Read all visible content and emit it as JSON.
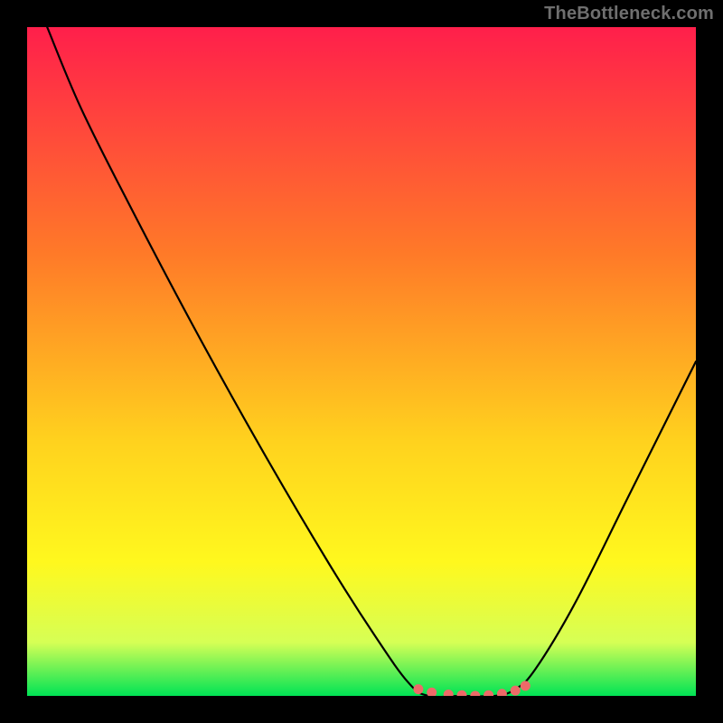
{
  "watermark": "TheBottleneck.com",
  "colors": {
    "bg_black": "#000000",
    "gradient_top": "#ff1f4b",
    "gradient_mid1": "#ff7a28",
    "gradient_mid2": "#ffd21e",
    "gradient_mid3": "#fff81e",
    "gradient_mid4": "#d6ff55",
    "gradient_bot": "#00e355",
    "curve": "#000000",
    "marker": "#ed6a68"
  },
  "chart_data": {
    "type": "line",
    "title": "",
    "xlabel": "",
    "ylabel": "",
    "xlim": [
      0,
      100
    ],
    "ylim": [
      0,
      100
    ],
    "grid": false,
    "legend": false,
    "curve": [
      {
        "x": 3,
        "y": 100
      },
      {
        "x": 8,
        "y": 88
      },
      {
        "x": 15,
        "y": 74
      },
      {
        "x": 25,
        "y": 55
      },
      {
        "x": 35,
        "y": 37
      },
      {
        "x": 45,
        "y": 20
      },
      {
        "x": 52,
        "y": 9
      },
      {
        "x": 57,
        "y": 2
      },
      {
        "x": 60,
        "y": 0
      },
      {
        "x": 65,
        "y": 0
      },
      {
        "x": 70,
        "y": 0
      },
      {
        "x": 73,
        "y": 1
      },
      {
        "x": 76,
        "y": 4
      },
      {
        "x": 82,
        "y": 14
      },
      {
        "x": 90,
        "y": 30
      },
      {
        "x": 100,
        "y": 50
      }
    ],
    "flat_band": {
      "x_start": 59,
      "x_end": 74,
      "y": 0
    },
    "markers": [
      {
        "x": 58.5,
        "y": 1.0
      },
      {
        "x": 60.5,
        "y": 0.5
      },
      {
        "x": 63.0,
        "y": 0.2
      },
      {
        "x": 65.0,
        "y": 0.1
      },
      {
        "x": 67.0,
        "y": 0.0
      },
      {
        "x": 69.0,
        "y": 0.1
      },
      {
        "x": 71.0,
        "y": 0.3
      },
      {
        "x": 73.0,
        "y": 0.8
      },
      {
        "x": 74.5,
        "y": 1.5
      }
    ]
  }
}
